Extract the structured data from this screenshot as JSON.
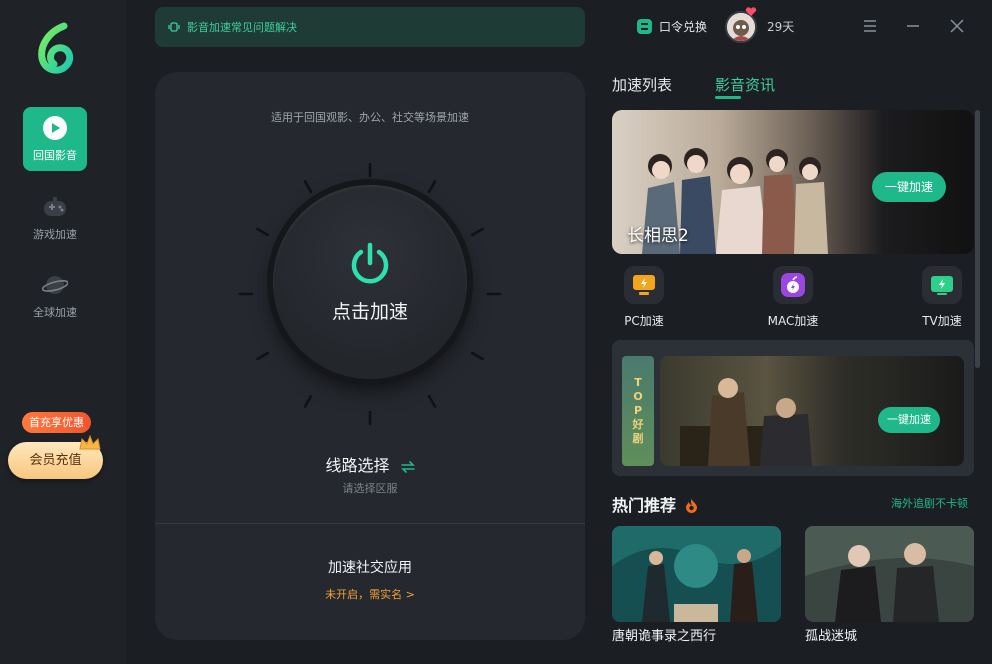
{
  "sidebar": {
    "items": [
      {
        "label": "回国影音",
        "icon": "play-circle-icon",
        "active": true
      },
      {
        "label": "游戏加速",
        "icon": "gamepad-icon",
        "active": false
      },
      {
        "label": "全球加速",
        "icon": "planet-icon",
        "active": false
      }
    ],
    "promo_badge": "首充享优惠",
    "recharge_label": "会员充值"
  },
  "notice": {
    "text": "影音加速常见问题解决"
  },
  "main": {
    "subtitle": "适用于回国观影、办公、社交等场景加速",
    "power_label": "点击加速",
    "route_title": "线路选择",
    "route_sub": "请选择区服",
    "social_title": "加速社交应用",
    "social_status": "未开启，需实名 >"
  },
  "topbar": {
    "redeem_label": "口令兑换",
    "days": "29天"
  },
  "tabs": [
    {
      "label": "加速列表",
      "active": false
    },
    {
      "label": "影音资讯",
      "active": true
    }
  ],
  "banner": {
    "title": "长相思2",
    "button": "一键加速"
  },
  "platforms": [
    {
      "label": "PC加速",
      "icon": "monitor-icon",
      "color": "#f2a51d"
    },
    {
      "label": "MAC加速",
      "icon": "apple-icon",
      "color": "#9b46e0"
    },
    {
      "label": "TV加速",
      "icon": "tv-icon",
      "color": "#2ecf8a"
    }
  ],
  "top_card": {
    "ribbon": [
      "T",
      "O",
      "P",
      "好",
      "剧"
    ],
    "button": "一键加速"
  },
  "hot": {
    "title": "热门推荐",
    "link": "海外追剧不卡顿",
    "items": [
      {
        "title": "唐朝诡事录之西行"
      },
      {
        "title": "孤战迷城"
      }
    ]
  },
  "colors": {
    "accent": "#1fb88a",
    "background": "#1b1e23",
    "card": "#25282e",
    "warning": "#f0a23a"
  }
}
